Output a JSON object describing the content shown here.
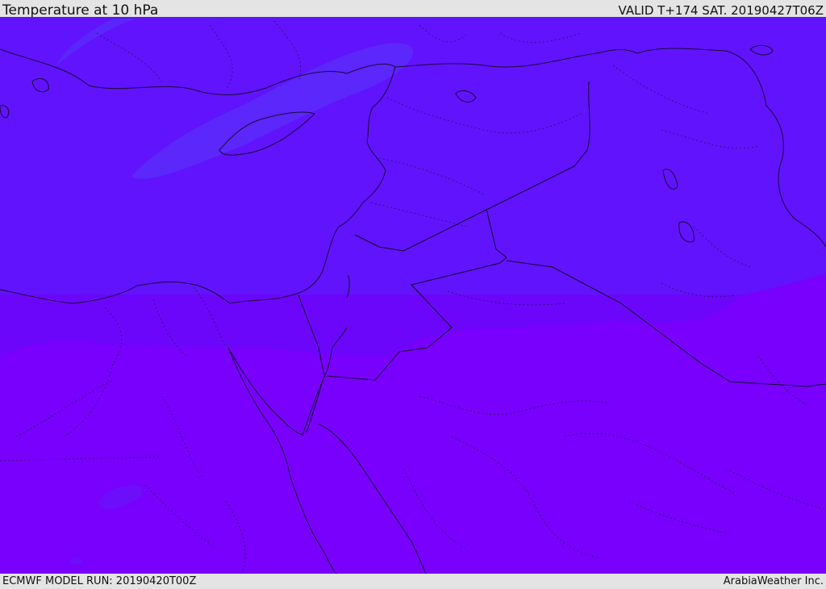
{
  "header": {
    "title": "Temperature at 10 hPa",
    "valid": "VALID T+174 SAT. 20190427T06Z"
  },
  "footer": {
    "model_run": "ECMWF MODEL RUN: 20190420T00Z",
    "credit": "ArabiaWeather Inc."
  },
  "map": {
    "colors": {
      "band_cold": "#6113fd",
      "band_mid": "#6c06fb",
      "band_warm": "#7800fc",
      "patch_cool": "#5a2cfa",
      "coast": "#1a0a3a"
    }
  }
}
